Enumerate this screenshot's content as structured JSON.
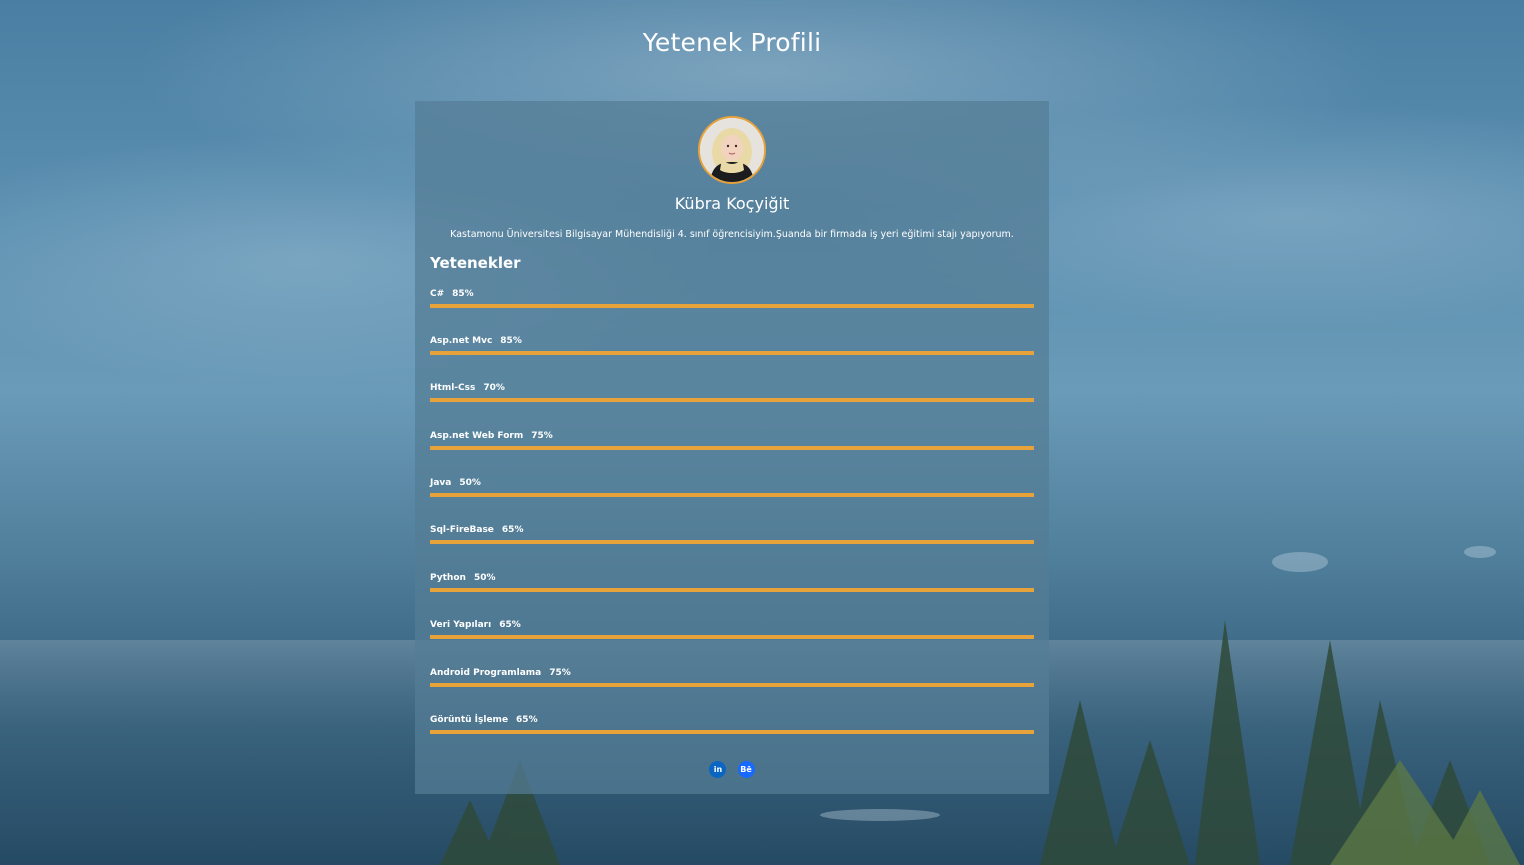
{
  "page": {
    "title": "Yetenek Profili"
  },
  "profile": {
    "name": "Kübra Koçyiğit",
    "bio": "Kastamonu Üniversitesi Bilgisayar Mühendisliği 4. sınıf öğrencisiyim.Şuanda bir firmada iş yeri eğitimi stajı yapıyorum."
  },
  "skills_section": {
    "heading": "Yetenekler",
    "bar_color": "#e8a23a",
    "items": [
      {
        "name": "C#",
        "percent_label": "85%",
        "level": 1.0
      },
      {
        "name": "Asp.net Mvc",
        "percent_label": "85%",
        "level": 1.0
      },
      {
        "name": "Html-Css",
        "percent_label": "70%",
        "level": 1.0
      },
      {
        "name": "Asp.net Web Form",
        "percent_label": "75%",
        "level": 1.0
      },
      {
        "name": "Java",
        "percent_label": "50%",
        "level": 1.0
      },
      {
        "name": "Sql-FireBase",
        "percent_label": "65%",
        "level": 1.0
      },
      {
        "name": "Python",
        "percent_label": "50%",
        "level": 1.0
      },
      {
        "name": "Veri Yapıları",
        "percent_label": "65%",
        "level": 1.0
      },
      {
        "name": "Android Programlama",
        "percent_label": "75%",
        "level": 1.0
      },
      {
        "name": "Görüntü İşleme",
        "percent_label": "65%",
        "level": 1.0
      }
    ]
  },
  "socials": [
    {
      "icon": "linkedin-icon",
      "label": "in",
      "color": "#0a66c2"
    },
    {
      "icon": "behance-icon",
      "label": "Bē",
      "color": "#1769ff"
    }
  ]
}
